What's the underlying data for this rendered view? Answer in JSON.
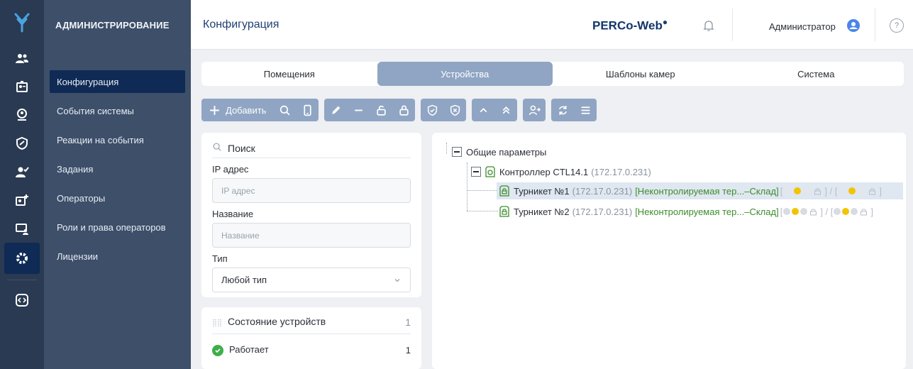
{
  "nav": {
    "title": "АДМИНИСТРИРОВАНИЕ",
    "items": [
      {
        "label": "Конфигурация"
      },
      {
        "label": "События системы"
      },
      {
        "label": "Реакции на события"
      },
      {
        "label": "Задания"
      },
      {
        "label": "Операторы"
      },
      {
        "label": "Роли и права операторов"
      },
      {
        "label": "Лицензии"
      }
    ]
  },
  "header": {
    "title": "Конфигурация",
    "brand": "PERCo-Web",
    "user": "Администратор",
    "help": "?"
  },
  "tabs": [
    {
      "label": "Помещения"
    },
    {
      "label": "Устройства"
    },
    {
      "label": "Шаблоны камер"
    },
    {
      "label": "Система"
    }
  ],
  "toolbar": {
    "add_label": "Добавить"
  },
  "filter": {
    "search_label": "Поиск",
    "ip_label": "IP адрес",
    "ip_placeholder": "IP адрес",
    "name_label": "Название",
    "name_placeholder": "Название",
    "type_label": "Тип",
    "type_value": "Любой тип"
  },
  "device_status": {
    "title": "Состояние устройств",
    "count": "1",
    "rows": [
      {
        "label": "Работает",
        "count": "1"
      }
    ]
  },
  "tree": {
    "root": "Общие параметры",
    "controller": {
      "name": "Контроллер CTL14.1",
      "ip": "(172.17.0.231)"
    },
    "devices": [
      {
        "name": "Турникет №1",
        "ip": "(172.17.0.231)",
        "zone": "[Неконтролируемая тер...–Склад]",
        "state_a": "[",
        "state_mid": "] / [",
        "state_end": "]"
      },
      {
        "name": "Турникет №2",
        "ip": "(172.17.0.231)",
        "zone": "[Неконтролируемая тер...–Склад]",
        "state_a": "[",
        "state_mid": "] / [",
        "state_end": "]"
      }
    ]
  },
  "colors": {
    "rail": "#2a3a52",
    "nav": "#3d4f69",
    "active": "#0f2a55",
    "accent": "#8fa5c3",
    "ok": "#3fae4a",
    "zone": "#3d8c2b",
    "indicator": "#f2c400"
  }
}
